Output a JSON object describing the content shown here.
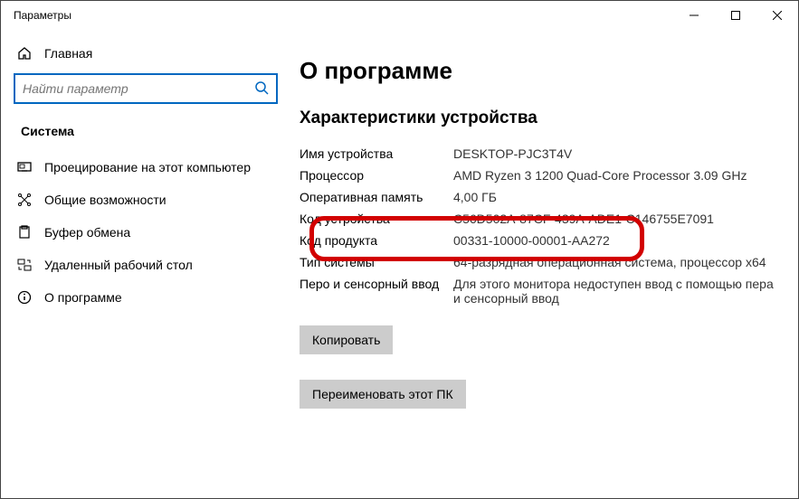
{
  "window": {
    "title": "Параметры"
  },
  "sidebar": {
    "home": "Главная",
    "searchPlaceholder": "Найти параметр",
    "section": "Система",
    "items": [
      {
        "label": "Проецирование на этот компьютер"
      },
      {
        "label": "Общие возможности"
      },
      {
        "label": "Буфер обмена"
      },
      {
        "label": "Удаленный рабочий стол"
      },
      {
        "label": "О программе"
      }
    ]
  },
  "page": {
    "title": "О программе",
    "subheading": "Характеристики устройства",
    "specs": [
      {
        "label": "Имя устройства",
        "value": "DESKTOP-PJC3T4V"
      },
      {
        "label": "Процессор",
        "value": "AMD Ryzen 3 1200 Quad-Core Processor 3.09 GHz"
      },
      {
        "label": "Оперативная память",
        "value": "4,00 ГБ"
      },
      {
        "label": "Код устройства",
        "value": "C56D502A-87CF-439A-ADE1-C146755E7091"
      },
      {
        "label": "Код продукта",
        "value": "00331-10000-00001-AA272"
      },
      {
        "label": "Тип системы",
        "value": "64-разрядная операционная система, процессор x64"
      },
      {
        "label": "Перо и сенсорный ввод",
        "value": "Для этого монитора недоступен ввод с помощью пера и сенсорный ввод"
      }
    ],
    "copyBtn": "Копировать",
    "renameBtn": "Переименовать этот ПК"
  }
}
